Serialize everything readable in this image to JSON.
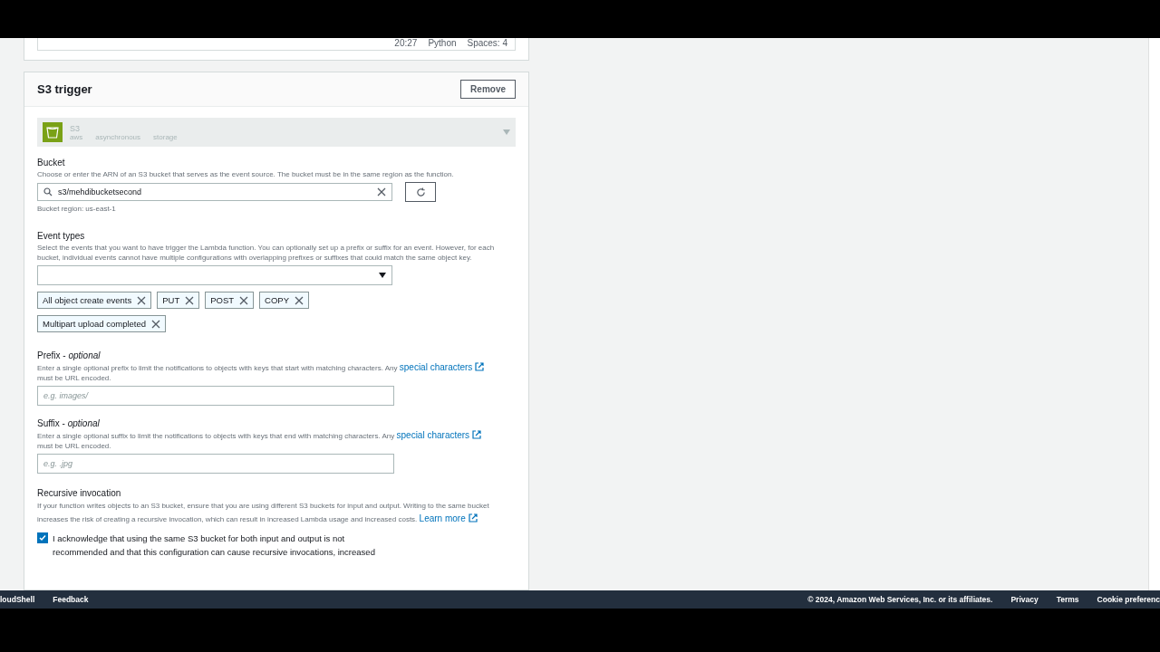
{
  "editor_status": [
    "20:27",
    "Python",
    "Spaces: 4"
  ],
  "trigger": {
    "title": "S3 trigger",
    "remove_button": "Remove",
    "source": {
      "name": "S3",
      "tags": [
        "aws",
        "asynchronous",
        "storage"
      ]
    },
    "bucket": {
      "label": "Bucket",
      "description": "Choose or enter the ARN of an S3 bucket that serves as the event source. The bucket must be in the same region as the function.",
      "value": "s3/mehdibucketsecond",
      "region": "Bucket region: us-east-1"
    },
    "event_types": {
      "label": "Event types",
      "description": "Select the events that you want to have trigger the Lambda function. You can optionally set up a prefix or suffix for an event. However, for each bucket, individual events cannot have multiple configurations with overlapping prefixes or suffixes that could match the same object key.",
      "selected": [
        "All object create events",
        "PUT",
        "POST",
        "COPY",
        "Multipart upload completed"
      ]
    },
    "prefix": {
      "label": "Prefix - *optional*",
      "description": "Enter a single optional prefix to limit the notifications to objects with keys that start with matching characters. Any",
      "link": "special characters",
      "description_end": "must be URL encoded.",
      "placeholder": "e.g. images/"
    },
    "suffix": {
      "label": "Suffix - *optional*",
      "description": "Enter a single optional suffix to limit the notifications to objects with keys that end with matching characters. Any",
      "link": "special characters",
      "description_end": "must be URL encoded.",
      "placeholder": "e.g. .jpg"
    },
    "recursive": {
      "label": "Recursive invocation",
      "description": "If your function writes objects to an S3 bucket, ensure that you are using different S3 buckets for input and output. Writing to the same bucket increases the risk of creating a recursive invocation, which can result in increased Lambda usage and increased costs.",
      "link": "Learn more",
      "checkbox": {
        "label": "I acknowledge that using the same S3 bucket for both input and output is not recommended and that this configuration can cause recursive invocations, increased",
        "checked": true
      }
    }
  },
  "footer": {
    "left": [
      "loudShell",
      "Feedback"
    ],
    "copyright": "© 2024, Amazon Web Services, Inc. or its affiliates.",
    "links": [
      "Privacy",
      "Terms",
      "Cookie preferenc"
    ]
  }
}
